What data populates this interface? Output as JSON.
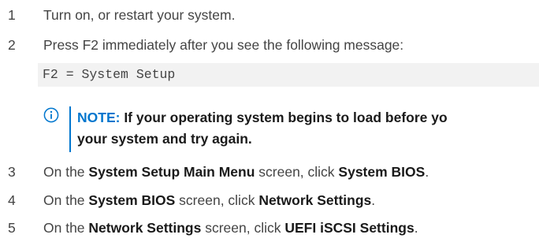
{
  "steps": [
    {
      "num": "1",
      "text": "Turn on, or restart your system."
    },
    {
      "num": "2",
      "text": "Press F2 immediately after you see the following message:"
    },
    {
      "num": "3",
      "pre": "On the ",
      "b1": "System Setup Main Menu",
      "mid": " screen, click ",
      "b2": "System BIOS",
      "post": "."
    },
    {
      "num": "4",
      "pre": "On the ",
      "b1": "System BIOS",
      "mid": " screen, click ",
      "b2": "Network Settings",
      "post": "."
    },
    {
      "num": "5",
      "pre": "On the ",
      "b1": "Network Settings",
      "mid": " screen, click ",
      "b2": "UEFI iSCSI Settings",
      "post": "."
    }
  ],
  "code": "F2 = System Setup",
  "note": {
    "label": "NOTE:",
    "line1": " If your operating system begins to load before yo",
    "line2": "your system and try again."
  },
  "colors": {
    "accent": "#0076ce",
    "text": "#444444",
    "code_bg": "#f2f2f2"
  }
}
